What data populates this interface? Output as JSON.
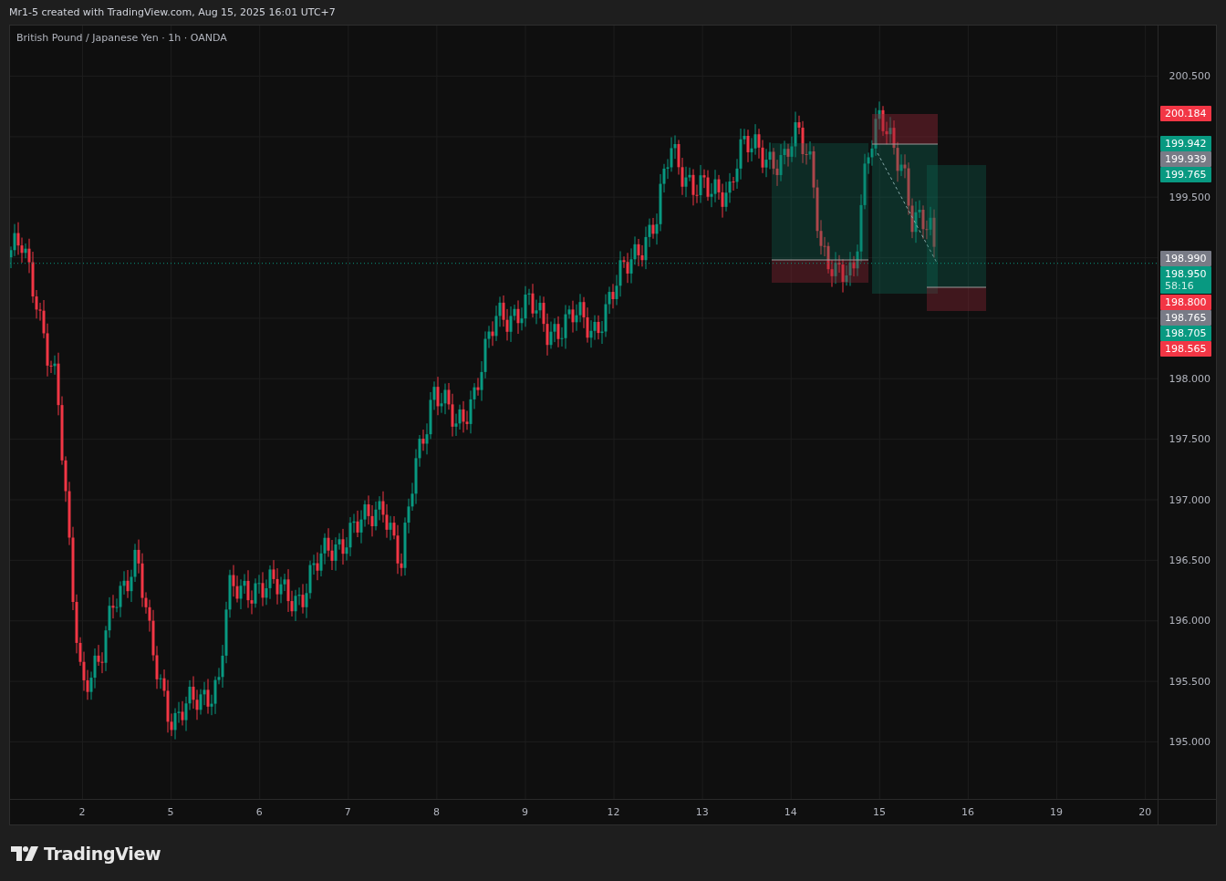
{
  "header": {
    "text": "Mr1-5 created with TradingView.com, Aug 15, 2025 16:01 UTC+7"
  },
  "chart": {
    "symbol_title": "British Pound / Japanese Yen · 1h · OANDA",
    "price_axis": {
      "ticks": [
        "200.500",
        "199.500",
        "198.000",
        "197.500",
        "197.000",
        "196.500",
        "196.000",
        "195.500",
        "195.000"
      ]
    },
    "time_axis": {
      "labels": [
        "2",
        "5",
        "6",
        "7",
        "8",
        "9",
        "12",
        "13",
        "14",
        "15",
        "16",
        "19",
        "20"
      ]
    },
    "price_tags": [
      {
        "text": "200.184",
        "color": "#f23645"
      },
      {
        "text": "199.942",
        "color": "#089981"
      },
      {
        "text": "199.939",
        "color": "#787b86"
      },
      {
        "text": "199.765",
        "color": "#089981"
      },
      {
        "text": "198.990",
        "color": "#787b86"
      },
      {
        "text": "198.950",
        "color": "#089981",
        "countdown": "58:16"
      },
      {
        "text": "198.800",
        "color": "#f23645"
      },
      {
        "text": "198.765",
        "color": "#787b86"
      },
      {
        "text": "198.705",
        "color": "#089981"
      },
      {
        "text": "198.565",
        "color": "#f23645"
      }
    ]
  },
  "footer": {
    "brand": "TradingView"
  }
}
